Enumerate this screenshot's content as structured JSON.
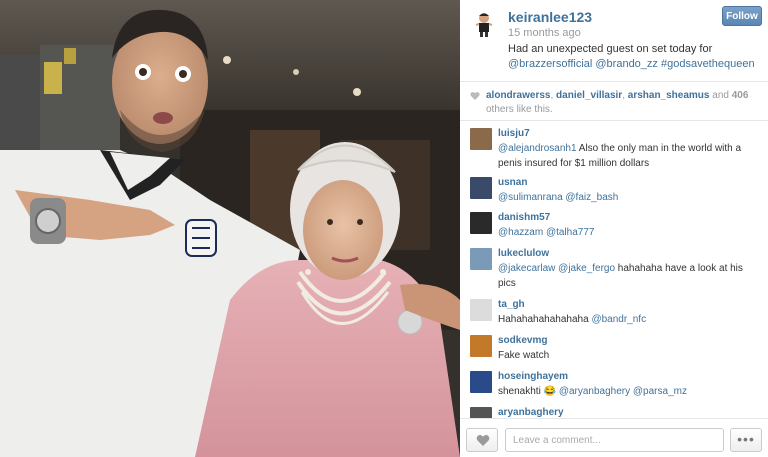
{
  "post": {
    "username": "keiranlee123",
    "time_ago": "15 months ago",
    "caption_text": "Had an unexpected guest on set today for",
    "caption_tags": "@brazzersofficial @brando_zz #godsavethequeen",
    "follow_label": "Follow",
    "photo_icon": "photo-of-man-and-queen-cutout"
  },
  "likes": {
    "users": [
      "alondrawerss",
      "daniel_villasir",
      "arshan_sheamus"
    ],
    "and_text": "and",
    "count": "406",
    "suffix": "others like this."
  },
  "comments": [
    {
      "user": "luisju7",
      "mention": "@alejandrosanh1",
      "text": " Also the only man in the world with a penis insured for $1 million dollars",
      "avatar_color": "#8a6a4a"
    },
    {
      "user": "usnan",
      "mention": "@sulimanrana @faiz_bash",
      "text": "",
      "avatar_color": "#3a4a6a"
    },
    {
      "user": "danishm57",
      "mention": "@hazzam @talha777",
      "text": "",
      "avatar_color": "#2a2a2a"
    },
    {
      "user": "lukeclulow",
      "mention": "@jakecarlaw @jake_fergo",
      "text": " hahahaha have a look at his pics",
      "avatar_color": "#7a9ab8"
    },
    {
      "user": "ta_gh",
      "mention": "",
      "text": "Hahahahahahahaha ",
      "mention2": "@bandr_nfc",
      "avatar_color": "#dcdcdc"
    },
    {
      "user": "sodkevmg",
      "mention": "",
      "text": "Fake watch",
      "avatar_color": "#c27a2a"
    },
    {
      "user": "hoseinghayem",
      "mention": "",
      "text": "shenakhti 😂 ",
      "mention2": "@aryanbaghery @parsa_mz",
      "avatar_color": "#2a4a8a"
    },
    {
      "user": "aryanbaghery",
      "mention": "",
      "text": "",
      "avatar_color": "#555555"
    }
  ],
  "footer": {
    "comment_placeholder": "Leave a comment...",
    "more_label": "•••"
  },
  "colors": {
    "link": "#3f729b",
    "follow_bg": "#6b93bd"
  }
}
